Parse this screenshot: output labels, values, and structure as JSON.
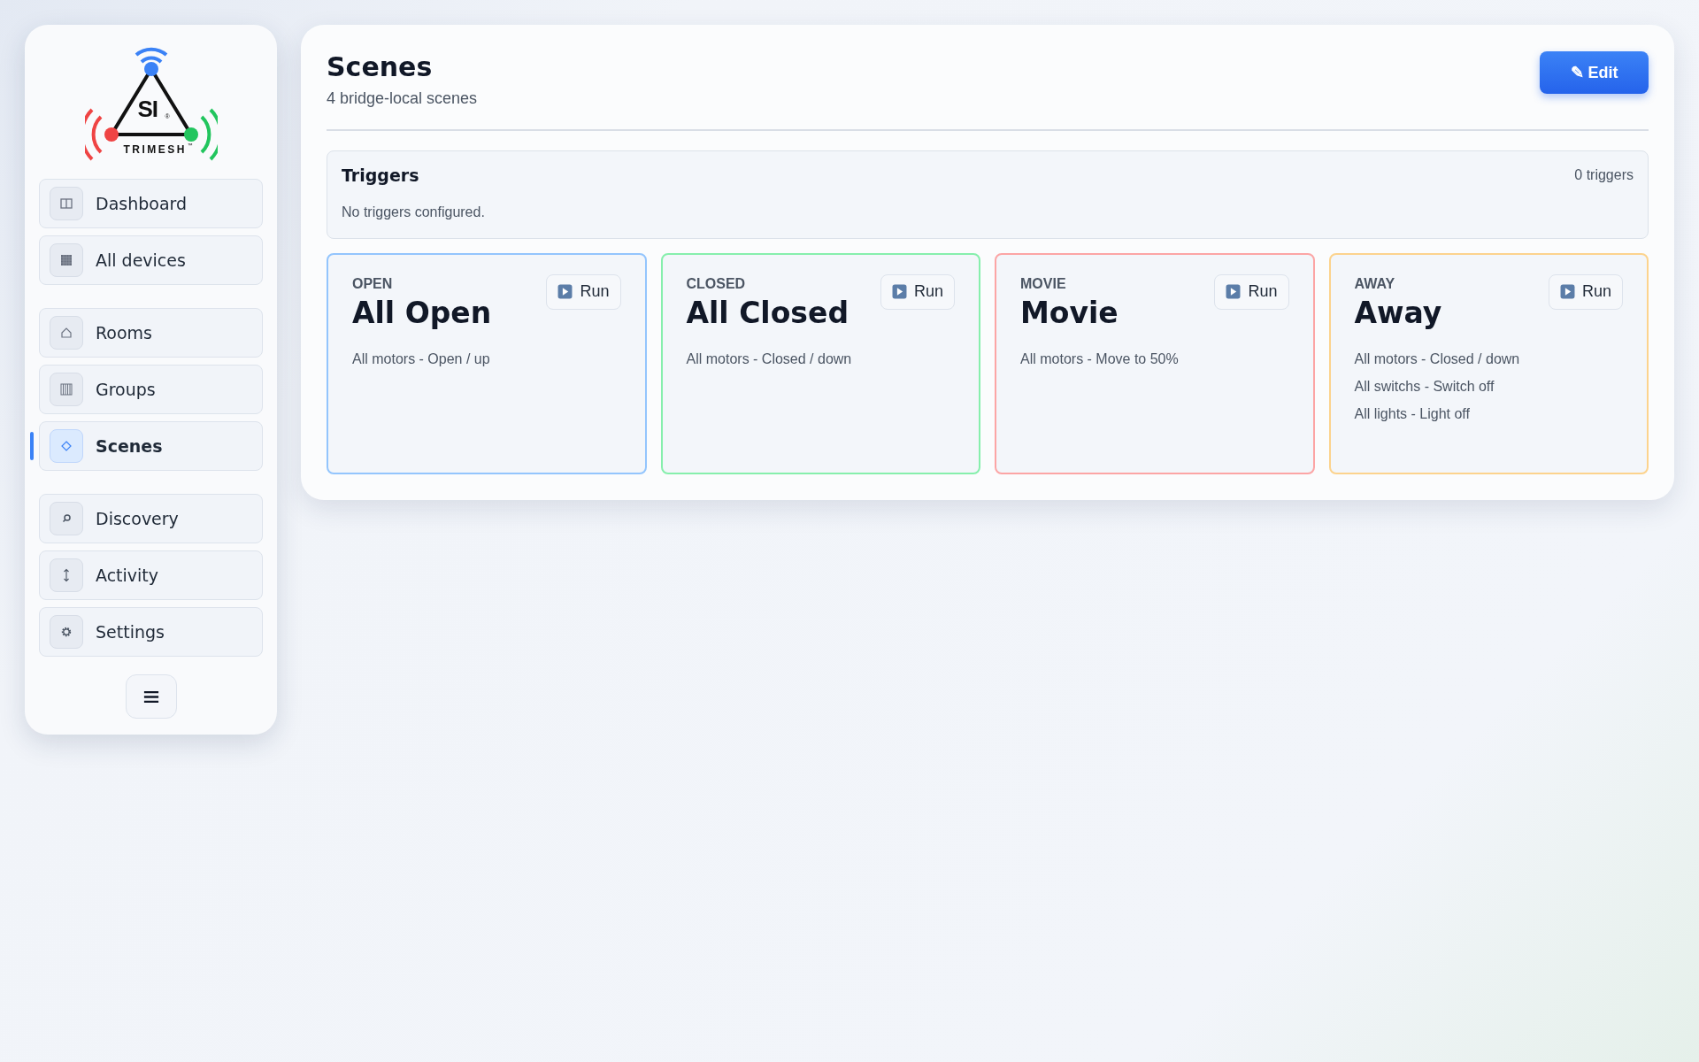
{
  "logo": {
    "mark": "SI",
    "registered": "®",
    "name": "TRIMESH",
    "trademark": "™"
  },
  "nav_sections": [
    {
      "items": [
        {
          "label": "Dashboard",
          "selected": false
        },
        {
          "label": "All devices",
          "selected": false
        }
      ]
    },
    {
      "items": [
        {
          "label": "Rooms",
          "selected": false
        },
        {
          "label": "Groups",
          "selected": false
        },
        {
          "label": "Scenes",
          "selected": true
        }
      ]
    },
    {
      "items": [
        {
          "label": "Discovery",
          "selected": false
        },
        {
          "label": "Activity",
          "selected": false
        },
        {
          "label": "Settings",
          "selected": false
        }
      ]
    }
  ],
  "page": {
    "title": "Scenes",
    "subtitle": "4 bridge-local scenes",
    "edit_button": {
      "icon": "✎",
      "label": "Edit"
    }
  },
  "triggers": {
    "title": "Triggers",
    "count": "0 triggers",
    "empty_text": "No triggers configured."
  },
  "scenes": [
    {
      "tag": "OPEN",
      "name": "All Open",
      "color": "#93c5fd",
      "run_label": "Run",
      "actions": [
        "All motors - Open / up"
      ]
    },
    {
      "tag": "CLOSED",
      "name": "All Closed",
      "color": "#86efac",
      "run_label": "Run",
      "actions": [
        "All motors - Closed / down"
      ]
    },
    {
      "tag": "MOVIE",
      "name": "Movie",
      "color": "#fca5a5",
      "run_label": "Run",
      "actions": [
        "All motors - Move to 50%"
      ]
    },
    {
      "tag": "AWAY",
      "name": "Away",
      "color": "#fcd38d",
      "run_label": "Run",
      "actions": [
        "All motors - Closed / down",
        "All switchs - Switch off",
        "All lights - Light off"
      ]
    }
  ]
}
